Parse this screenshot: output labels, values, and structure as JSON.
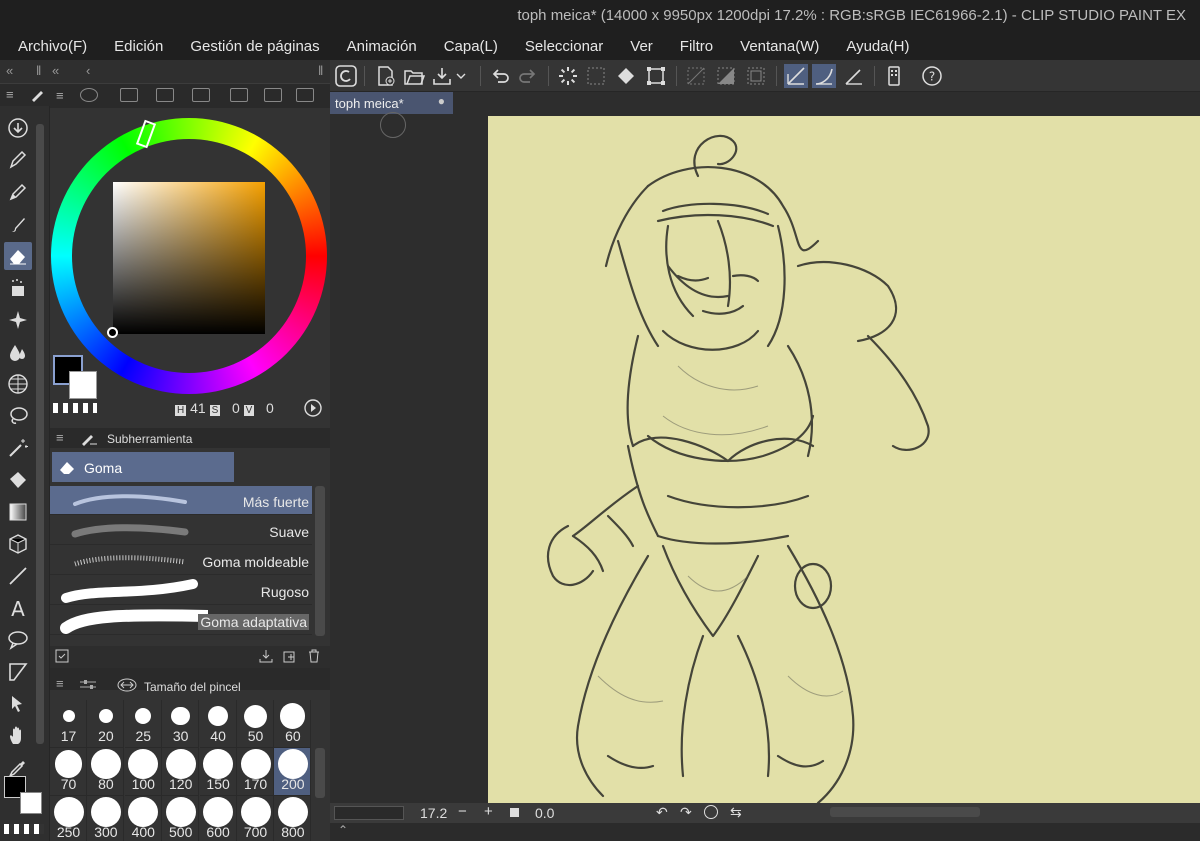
{
  "window": {
    "title": "toph meica* (14000 x 9950px 1200dpi 17.2% : RGB:sRGB IEC61966-2.1)  - CLIP STUDIO PAINT EX"
  },
  "menu": [
    "Archivo(F)",
    "Edición",
    "Gestión de páginas",
    "Animación",
    "Capa(L)",
    "Seleccionar",
    "Ver",
    "Filtro",
    "Ventana(W)",
    "Ayuda(H)"
  ],
  "colors": {
    "accent": "#5b6b8e",
    "paper": "#e2e0a8",
    "main_color": "#000000",
    "sub_color": "#ffffff"
  },
  "color_panel": {
    "h_label": "H",
    "h_value": "41",
    "s_label": "S",
    "s_value": "0",
    "v_label": "V",
    "v_value": "0"
  },
  "subtool": {
    "header": "Subherramienta",
    "group": "Goma",
    "brushes": [
      {
        "name": "Más fuerte",
        "selected": true
      },
      {
        "name": "Suave",
        "selected": false
      },
      {
        "name": "Goma moldeable",
        "selected": false
      },
      {
        "name": "Rugoso",
        "selected": false
      },
      {
        "name": "Goma adaptativa",
        "selected": false
      }
    ]
  },
  "brush_size": {
    "header": "Tamaño del pincel",
    "sizes": [
      "17",
      "20",
      "25",
      "30",
      "40",
      "50",
      "60",
      "70",
      "80",
      "100",
      "120",
      "150",
      "170",
      "200",
      "250",
      "300",
      "400",
      "500",
      "600",
      "700",
      "800"
    ],
    "selected": "200"
  },
  "document": {
    "tab_label": "toph meica*"
  },
  "status": {
    "zoom": "17.2",
    "rotation": "0.0"
  },
  "icons": [
    "download-icon",
    "pen-icon",
    "pencil-icon",
    "brush-icon",
    "eraser-icon",
    "blend-icon",
    "sparkle-icon",
    "drops-icon",
    "grid-icon",
    "lasso-icon",
    "wand-icon",
    "fill-icon",
    "gradient-icon",
    "cube-icon",
    "line-icon",
    "text-icon",
    "balloon-icon",
    "frame-icon",
    "move-icon",
    "hand-icon",
    "eyedropper-icon"
  ]
}
